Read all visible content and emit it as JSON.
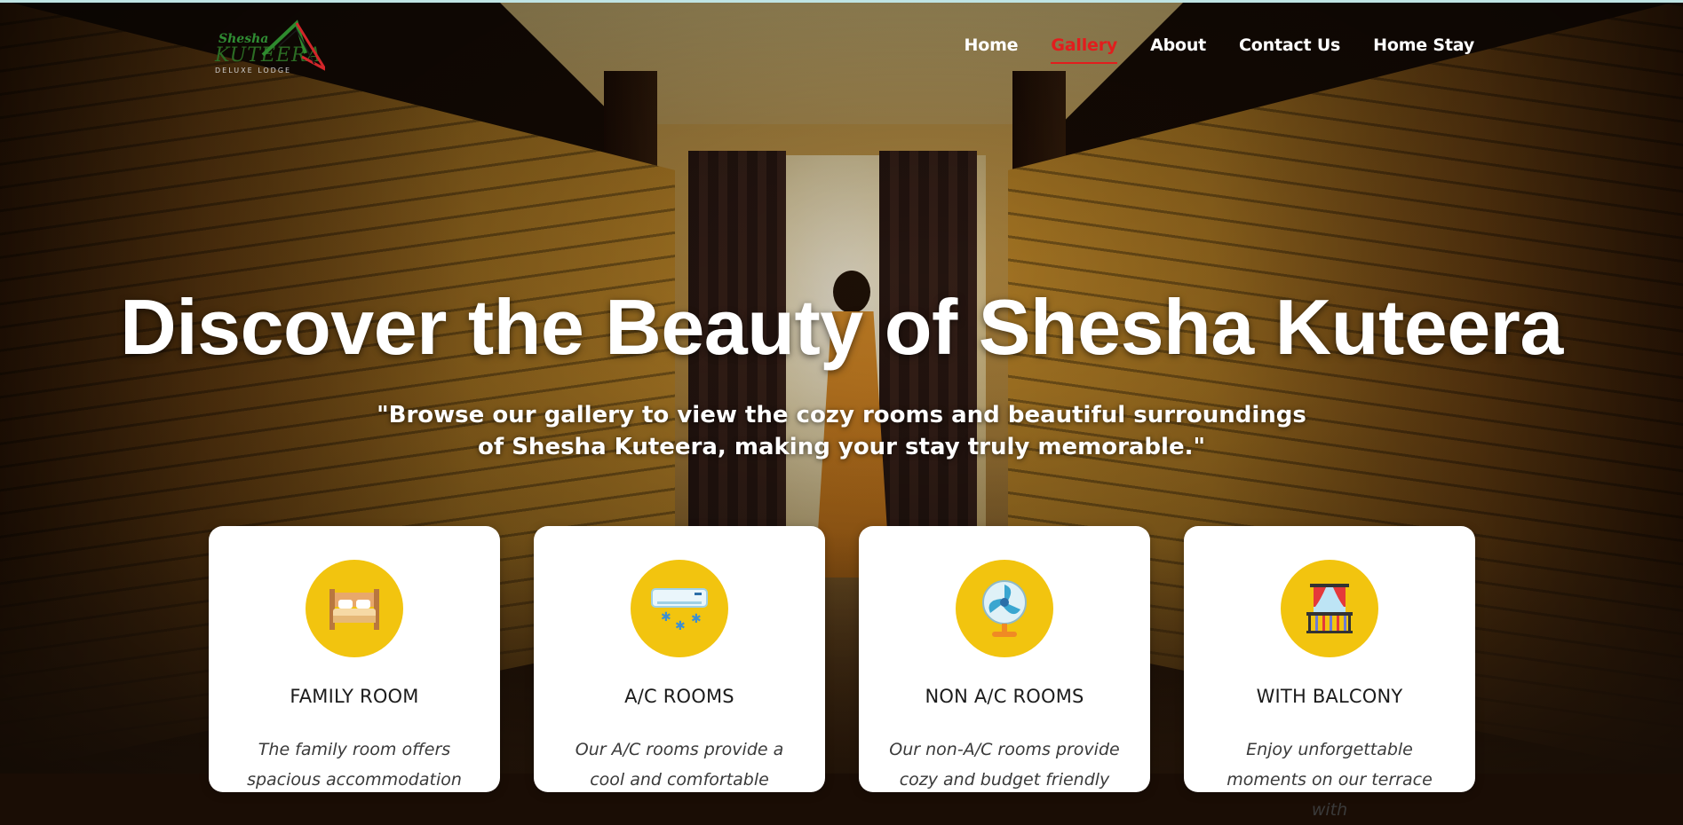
{
  "brand": {
    "script": "Shesha",
    "word": "KUTEERA",
    "tagline": "DELUXE LODGE"
  },
  "nav": {
    "items": [
      {
        "label": "Home",
        "active": false
      },
      {
        "label": "Gallery",
        "active": true
      },
      {
        "label": "About",
        "active": false
      },
      {
        "label": "Contact Us",
        "active": false
      },
      {
        "label": "Home Stay",
        "active": false
      }
    ],
    "active_color": "#e21d1d"
  },
  "hero": {
    "title": "Discover the Beauty of Shesha Kuteera",
    "subtitle_line1": "\"Browse our gallery to view the cozy rooms and beautiful surroundings",
    "subtitle_line2": "of Shesha Kuteera, making your stay truly memorable.\""
  },
  "cards": [
    {
      "icon": "bed-icon",
      "title": "FAMILY ROOM",
      "desc_line1": "The family room offers",
      "desc_line2": "spacious accommodation"
    },
    {
      "icon": "air-conditioner-icon",
      "title": "A/C ROOMS",
      "desc_line1": "Our A/C rooms provide a",
      "desc_line2": "cool and comfortable"
    },
    {
      "icon": "fan-icon",
      "title": "NON A/C ROOMS",
      "desc_line1": "Our non-A/C rooms provide",
      "desc_line2": "cozy and budget friendly"
    },
    {
      "icon": "balcony-icon",
      "title": "WITH BALCONY",
      "desc_line1": "Enjoy unforgettable",
      "desc_line2": "moments on our terrace with"
    }
  ],
  "colors": {
    "accent": "#e21d1d",
    "icon_bg": "#f2c40f",
    "top_line": "#bfe4e4"
  }
}
